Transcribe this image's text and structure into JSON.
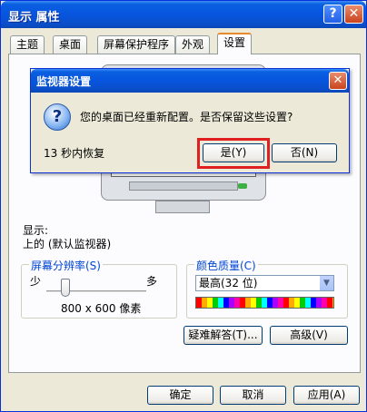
{
  "window": {
    "title": "显示 属性",
    "help_label": "?",
    "close_label": "✕"
  },
  "tabs": [
    {
      "label": "主题"
    },
    {
      "label": "桌面"
    },
    {
      "label": "屏幕保护程序"
    },
    {
      "label": "外观"
    },
    {
      "label": "设置"
    }
  ],
  "settings": {
    "display_label": "显示:",
    "display_value": "上的 (默认监视器)",
    "resolution_group": "屏幕分辨率(S)",
    "slider_less": "少",
    "slider_more": "多",
    "resolution_value": "800 x 600 像素",
    "color_group": "颜色质量(C)",
    "color_value": "最高(32 位)",
    "troubleshoot_button": "疑难解答(T)...",
    "advanced_button": "高级(V)"
  },
  "footer": {
    "ok": "确定",
    "cancel": "取消",
    "apply": "应用(A)"
  },
  "dialog": {
    "title": "监视器设置",
    "message": "您的桌面已经重新配置。是否保留这些设置?",
    "countdown": "13 秒内恢复",
    "yes_button": "是(Y)",
    "no_button": "否(N)",
    "icon": "question-icon",
    "highlight_color": "#e02020"
  }
}
